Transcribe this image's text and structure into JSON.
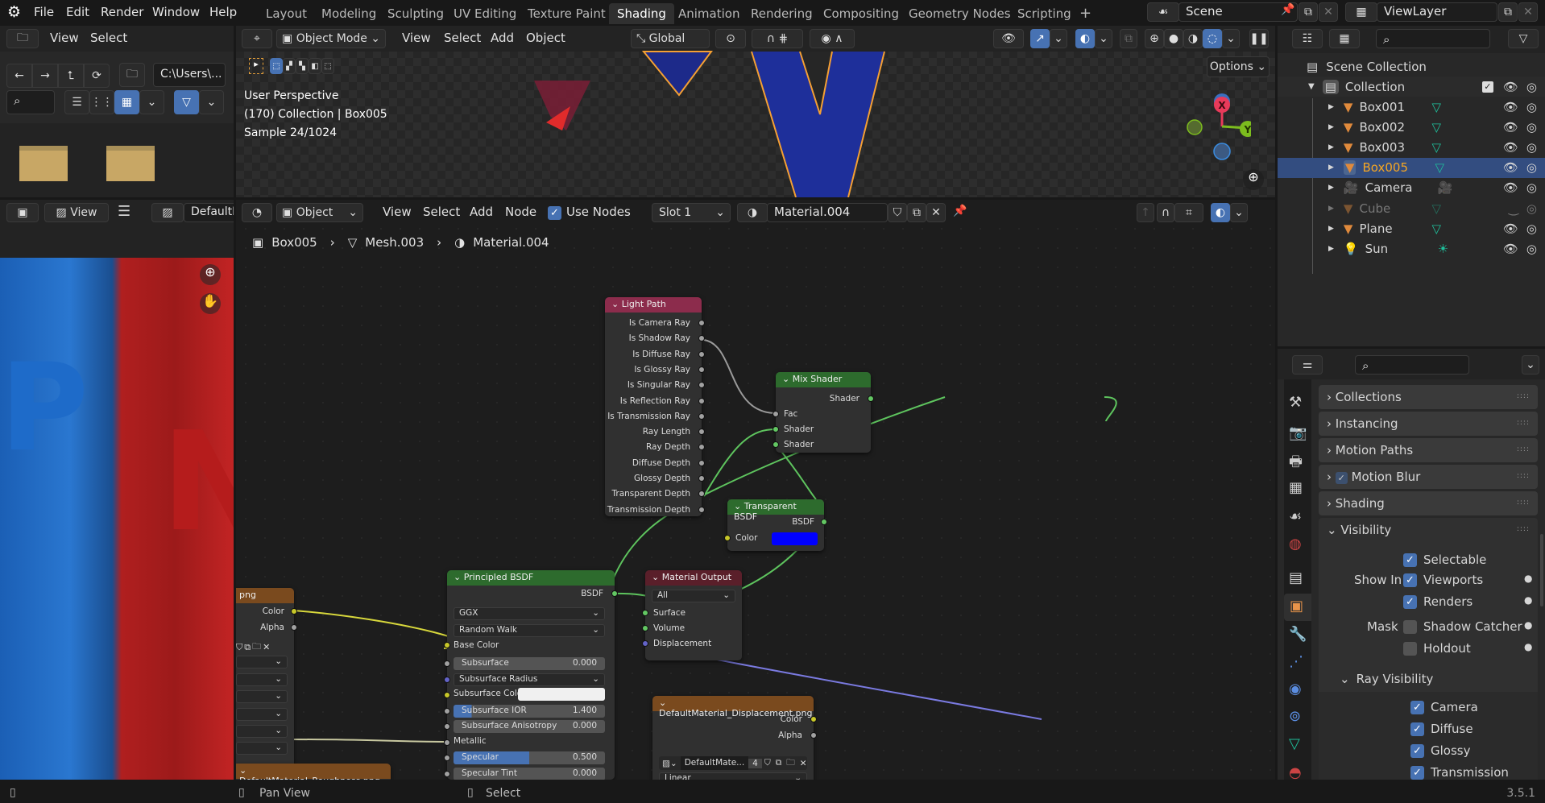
{
  "menubar": {
    "items": [
      "File",
      "Edit",
      "Render",
      "Window",
      "Help"
    ]
  },
  "workspaces": {
    "tabs": [
      "Layout",
      "Modeling",
      "Sculpting",
      "UV Editing",
      "Texture Paint",
      "Shading",
      "Animation",
      "Rendering",
      "Compositing",
      "Geometry Nodes",
      "Scripting"
    ],
    "active": "Shading",
    "add_label": "+"
  },
  "scene": {
    "name": "Scene",
    "view_layer": "ViewLayer"
  },
  "file_browser": {
    "menu": [
      "View",
      "Select"
    ],
    "path": "C:\\Users\\...",
    "folders": 2
  },
  "image_editor": {
    "view_label": "View",
    "image_name": "DefaultM"
  },
  "viewport": {
    "mode": "Object Mode",
    "menu": [
      "View",
      "Select",
      "Add",
      "Object"
    ],
    "orientation": "Global",
    "options_label": "Options",
    "overlay_lines": [
      "User Perspective",
      "(170) Collection | Box005",
      "Sample 24/1024"
    ],
    "gizmo": {
      "x": "X",
      "y": "Y"
    }
  },
  "node_editor": {
    "mode": "Object",
    "menu": [
      "View",
      "Select",
      "Add",
      "Node"
    ],
    "use_nodes_label": "Use Nodes",
    "use_nodes": true,
    "slot": "Slot 1",
    "material": "Material.004",
    "breadcrumb": [
      "Box005",
      "Mesh.003",
      "Material.004"
    ],
    "nodes": {
      "light_path": {
        "title": "Light Path",
        "outputs": [
          "Is Camera Ray",
          "Is Shadow Ray",
          "Is Diffuse Ray",
          "Is Glossy Ray",
          "Is Singular Ray",
          "Is Reflection Ray",
          "Is Transmission Ray",
          "Ray Length",
          "Ray Depth",
          "Diffuse Depth",
          "Glossy Depth",
          "Transparent Depth",
          "Transmission Depth"
        ]
      },
      "mix_shader": {
        "title": "Mix Shader",
        "output": "Shader",
        "inputs": [
          "Fac",
          "Shader",
          "Shader"
        ]
      },
      "transparent_bsdf": {
        "title": "Transparent BSDF",
        "output": "BSDF",
        "input": "Color",
        "color": "#0000ff"
      },
      "principled_bsdf": {
        "title": "Principled BSDF",
        "output": "BSDF",
        "distribution": "GGX",
        "subsurface_method": "Random Walk",
        "base_color_label": "Base Color",
        "fields": [
          {
            "label": "Subsurface",
            "value": "0.000",
            "fill": 0
          },
          {
            "label": "Subsurface Radius",
            "type": "select"
          },
          {
            "label": "Subsurface Color",
            "type": "color",
            "color": "#f0f0f0"
          },
          {
            "label": "Subsurface IOR",
            "value": "1.400",
            "fill": 0.12
          },
          {
            "label": "Subsurface Anisotropy",
            "value": "0.000",
            "fill": 0
          },
          {
            "label": "Metallic",
            "type": "socket"
          },
          {
            "label": "Specular",
            "value": "0.500",
            "fill": 0.5
          },
          {
            "label": "Specular Tint",
            "value": "0.000",
            "fill": 0
          }
        ]
      },
      "material_output": {
        "title": "Material Output",
        "target": "All",
        "inputs": [
          "Surface",
          "Volume",
          "Displacement"
        ]
      },
      "image_color": {
        "title": "png",
        "outputs": [
          "Color",
          "Alpha"
        ]
      },
      "roughness_tex": {
        "title": "DefaultMaterial_Roughness.png"
      },
      "displacement_tex": {
        "title": "DefaultMaterial_Displacement.png",
        "outputs": [
          "Color",
          "Alpha"
        ],
        "image": "DefaultMate...",
        "users": "4",
        "interpolation": "Linear"
      }
    }
  },
  "outliner": {
    "root": "Scene Collection",
    "collection": "Collection",
    "items": [
      {
        "name": "Box001",
        "type": "mesh",
        "selected": false,
        "visible": true
      },
      {
        "name": "Box002",
        "type": "mesh",
        "selected": false,
        "visible": true
      },
      {
        "name": "Box003",
        "type": "mesh",
        "selected": false,
        "visible": true
      },
      {
        "name": "Box005",
        "type": "mesh",
        "selected": true,
        "visible": true
      },
      {
        "name": "Camera",
        "type": "camera",
        "selected": false,
        "visible": true
      },
      {
        "name": "Cube",
        "type": "mesh",
        "selected": false,
        "visible": false
      },
      {
        "name": "Plane",
        "type": "mesh",
        "selected": false,
        "visible": true
      },
      {
        "name": "Sun",
        "type": "light",
        "selected": false,
        "visible": true
      }
    ]
  },
  "properties": {
    "panels": [
      {
        "label": "Collections",
        "open": false
      },
      {
        "label": "Instancing",
        "open": false
      },
      {
        "label": "Motion Paths",
        "open": false
      },
      {
        "label": "Motion Blur",
        "open": false,
        "checkbox": true
      },
      {
        "label": "Shading",
        "open": false
      },
      {
        "label": "Visibility",
        "open": true
      }
    ],
    "visibility": {
      "selectable": {
        "label": "Selectable",
        "checked": true
      },
      "show_in_label": "Show In",
      "viewports": {
        "label": "Viewports",
        "checked": true
      },
      "renders": {
        "label": "Renders",
        "checked": true
      },
      "mask_label": "Mask",
      "shadow_catcher": {
        "label": "Shadow Catcher",
        "checked": false
      },
      "holdout": {
        "label": "Holdout",
        "checked": false
      },
      "ray_visibility_label": "Ray Visibility",
      "rays": [
        {
          "label": "Camera",
          "checked": true
        },
        {
          "label": "Diffuse",
          "checked": true
        },
        {
          "label": "Glossy",
          "checked": true
        },
        {
          "label": "Transmission",
          "checked": true
        }
      ]
    }
  },
  "statusbar": {
    "left_hint": "",
    "pan_label": "Pan View",
    "select_label": "Select",
    "version": "3.5.1"
  },
  "colors": {
    "accent": "#4772b3",
    "selected_text": "#f5a623",
    "mesh_icon": "#e08a3c",
    "data_icon": "#1fbf9b"
  }
}
